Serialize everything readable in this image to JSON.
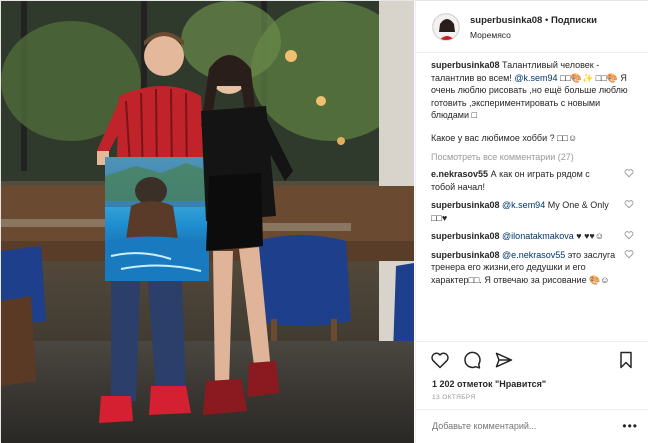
{
  "header": {
    "username": "superbusinka08",
    "separator": "•",
    "follow_label": "Подписки",
    "location": "Моремясо"
  },
  "caption": {
    "user": "superbusinka08",
    "text_1": "Талантливый человек - талантлив во всем! ",
    "mention": "@k.sem94",
    "text_2": " □□🎨✨ □□🎨 Я очень люблю рисовать ,но ещё больше люблю готовить ,экспериментировать с новыми блюдами □",
    "question": "Какое у вас любимое хобби ? □□☺"
  },
  "view_all_comments": "Посмотреть все комментарии (27)",
  "comments": [
    {
      "user": "e.nekrasov55",
      "parts": [
        {
          "t": "А как он играть рядом с тобой начал!"
        }
      ]
    },
    {
      "user": "superbusinka08",
      "parts": [
        {
          "m": "@k.sem94"
        },
        {
          "t": " My One & Only □□♥"
        }
      ]
    },
    {
      "user": "superbusinka08",
      "parts": [
        {
          "m": "@ilonatakmakova"
        },
        {
          "t": " ♥ ♥♥☺"
        }
      ]
    },
    {
      "user": "superbusinka08",
      "parts": [
        {
          "m": "@e.nekrasov55"
        },
        {
          "t": " это заслуга тренера его жизни,его дедушки и его характер□□. Я отвечаю за рисование 🎨☺"
        }
      ]
    }
  ],
  "likes": "1 202 отметок \"Нравится\"",
  "date": "13 ОКТЯБРЯ",
  "add_comment_placeholder": "Добавьте комментарий...",
  "icons": {
    "like": "heart-icon",
    "comment": "comment-icon",
    "share": "share-icon",
    "save": "bookmark-icon",
    "more": "more-options-icon"
  },
  "colors": {
    "mention": "#003569",
    "muted": "#999999",
    "text": "#262626"
  }
}
